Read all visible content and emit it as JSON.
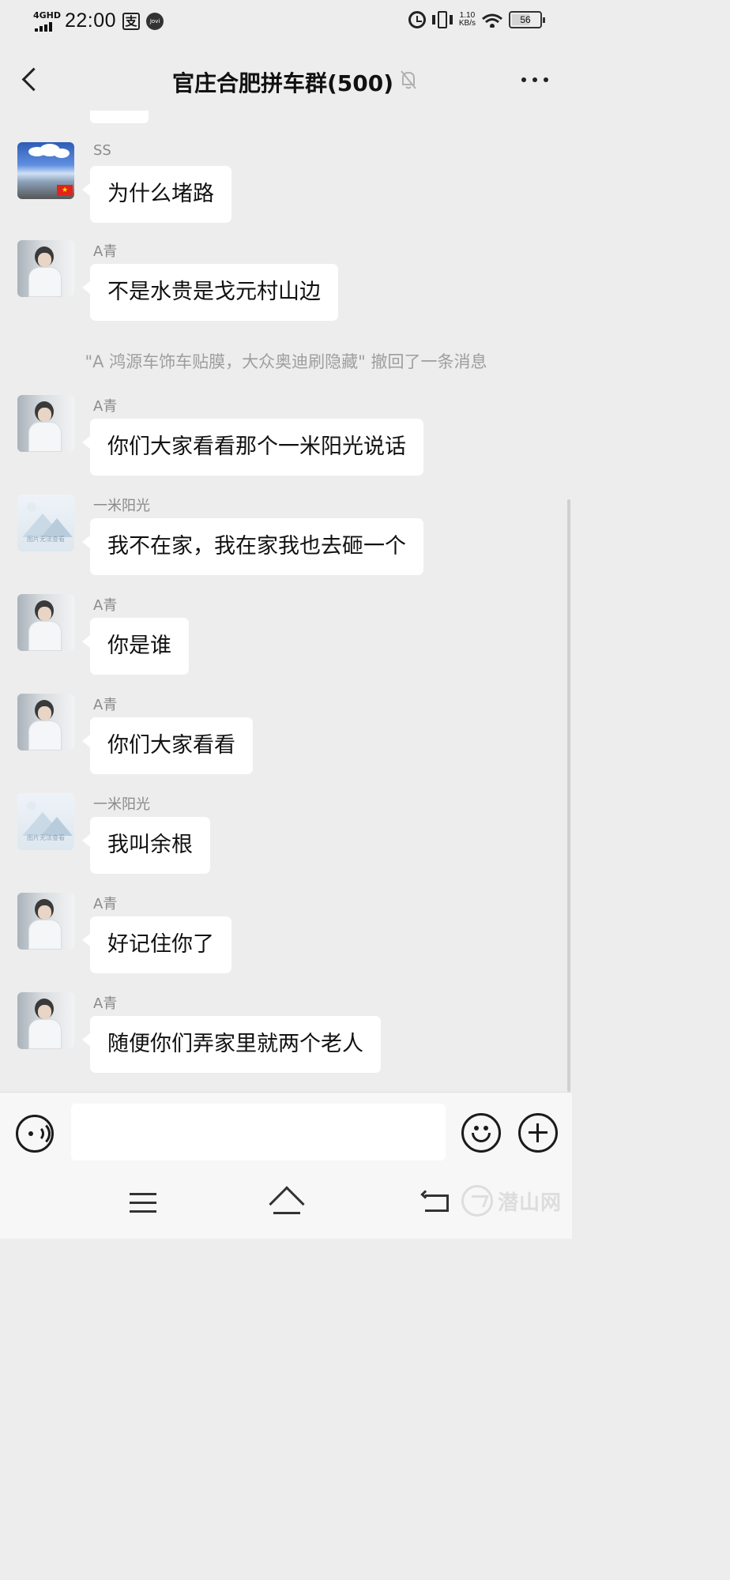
{
  "status_bar": {
    "network": "4GHD",
    "time": "22:00",
    "pay_icon": "支",
    "jovi_icon": "Jovi",
    "speed_value": "1.10",
    "speed_unit": "KB/s",
    "battery": "56"
  },
  "header": {
    "title": "官庄合肥拼车群(500)"
  },
  "messages": [
    {
      "sender": "SS",
      "text": "为什么堵路",
      "avatar": "landscape-flag"
    },
    {
      "sender": "A青",
      "text": "不是水贵是戈元村山边",
      "avatar": "person-photo"
    },
    {
      "system": "\"A 鸿源车饰车贴膜，大众奥迪刷隐藏\" 撤回了一条消息"
    },
    {
      "sender": "A青",
      "text": "你们大家看看那个一米阳光说话",
      "avatar": "person-photo"
    },
    {
      "sender": "一米阳光",
      "text": "我不在家，我在家我也去砸一个",
      "avatar": "image-unavailable",
      "avatar_caption": "图片无法查看"
    },
    {
      "sender": "A青",
      "text": "你是谁",
      "avatar": "person-photo"
    },
    {
      "sender": "A青",
      "text": "你们大家看看",
      "avatar": "person-photo"
    },
    {
      "sender": "一米阳光",
      "text": "我叫余根",
      "avatar": "image-unavailable",
      "avatar_caption": "图片无法查看"
    },
    {
      "sender": "A青",
      "text": "好记住你了",
      "avatar": "person-photo"
    },
    {
      "sender": "A青",
      "text": "随便你们弄家里就两个老人",
      "avatar": "person-photo"
    }
  ],
  "input_bar": {
    "value": "",
    "placeholder": ""
  },
  "watermark": "潜山网",
  "icons": {
    "back": "back-arrow-icon",
    "mute": "bell-off-icon",
    "more": "more-dots-icon",
    "voice": "voice-icon",
    "emoji": "emoji-icon",
    "plus": "plus-icon",
    "nav_menu": "menu-icon",
    "nav_home": "home-icon",
    "nav_back": "nav-back-icon"
  },
  "colors": {
    "background": "#ededed",
    "bubble": "#ffffff",
    "sender": "#8a8a8a",
    "system": "#9e9e9e"
  }
}
